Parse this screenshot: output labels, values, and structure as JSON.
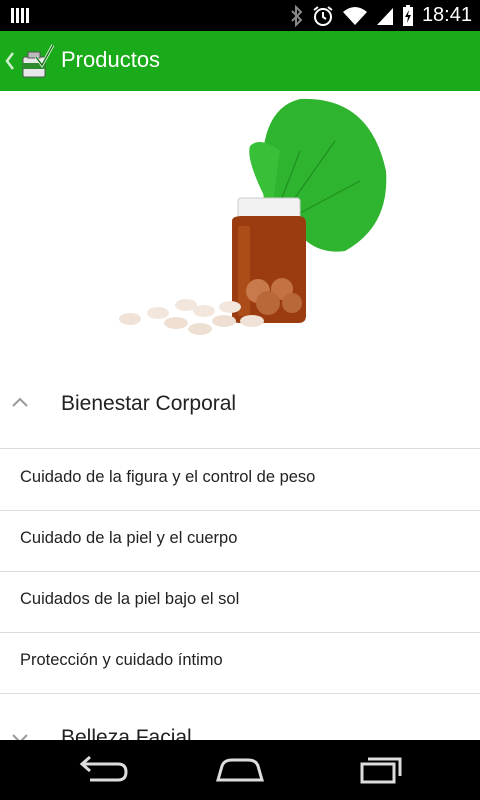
{
  "status_bar": {
    "time": "18:41",
    "icons": [
      "signal-bars-icon",
      "bluetooth-icon",
      "alarm-icon",
      "wifi-icon",
      "cell-signal-icon",
      "battery-icon"
    ]
  },
  "app_bar": {
    "title": "Productos",
    "back_icon": "chevron-left-icon",
    "logo_icon": "pharmacy-logo-icon",
    "color": "#1aab1a"
  },
  "hero_image": {
    "description_icon": "medicine-bottle-ginkgo-image"
  },
  "sections": [
    {
      "title": "Bienestar Corporal",
      "expanded": true,
      "items": [
        "Cuidado de la figura y el control de peso",
        "Cuidado de la piel y el cuerpo",
        "Cuidados de la piel bajo el sol",
        "Protección y cuidado íntimo"
      ]
    },
    {
      "title": "Belleza Facial",
      "expanded": false
    }
  ],
  "nav_bar": {
    "icons": [
      "back-icon",
      "home-icon",
      "recents-icon"
    ]
  }
}
